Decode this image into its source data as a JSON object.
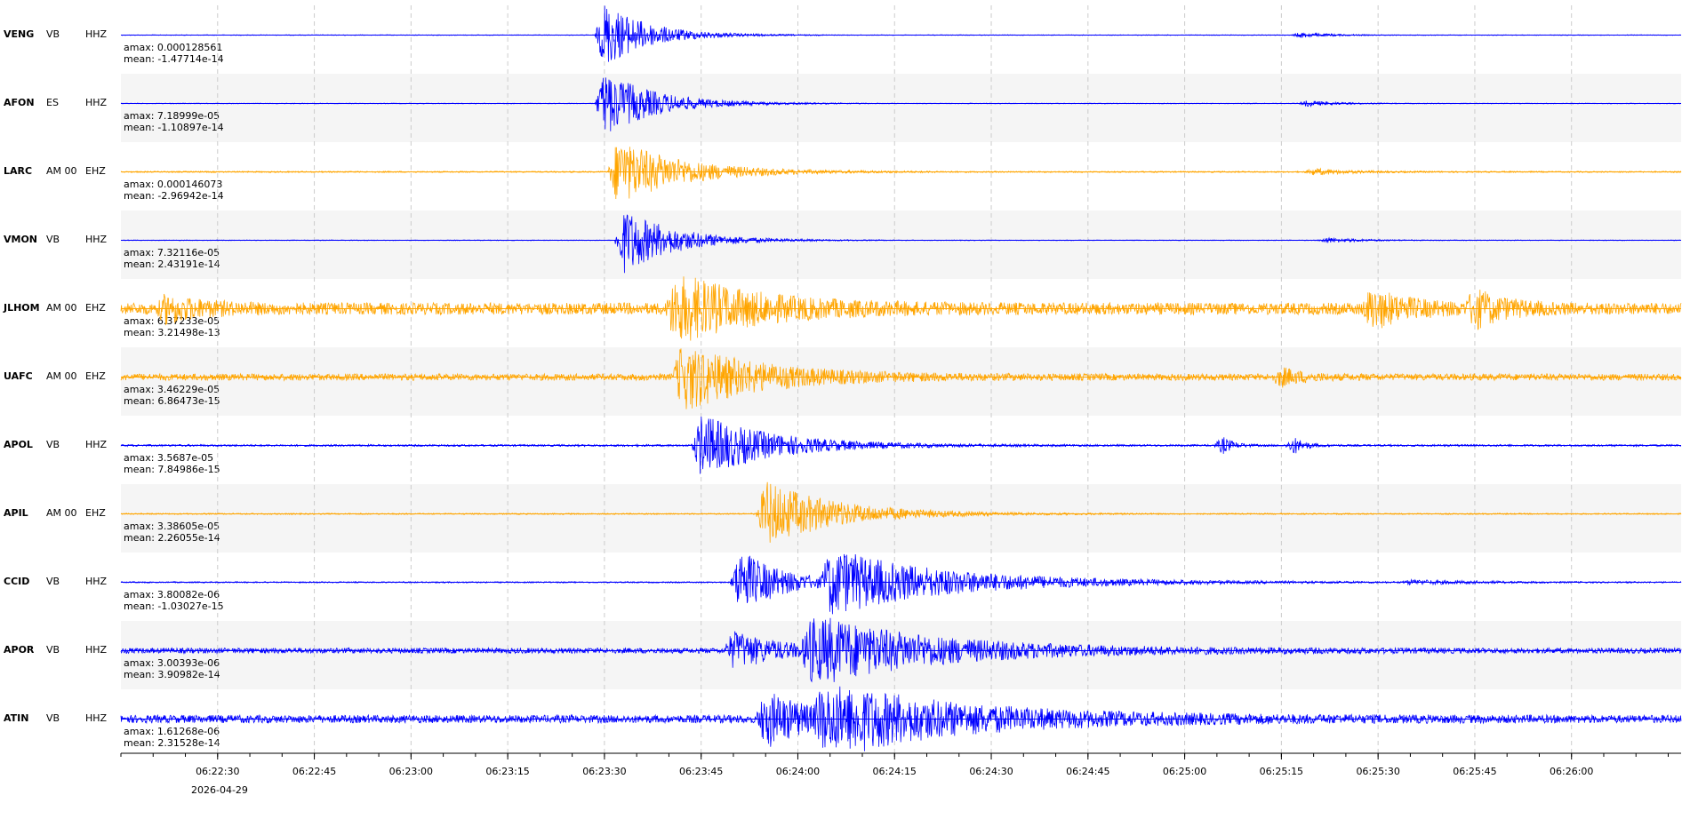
{
  "viewer": {
    "date": "2026-04-29",
    "time_ticks": [
      "06:22:30",
      "06:22:45",
      "06:23:00",
      "06:23:15",
      "06:23:30",
      "06:23:45",
      "06:24:00",
      "06:24:15",
      "06:24:30",
      "06:24:45",
      "06:25:00",
      "06:25:15",
      "06:25:30",
      "06:25:45",
      "06:26:00"
    ],
    "traces": [
      {
        "station": "VENG",
        "network": "VB",
        "location": "",
        "channel": "HHZ",
        "amax": "amax: 0.000128561",
        "mean": "mean: -1.47714e-14",
        "color": "#0000ff"
      },
      {
        "station": "AFON",
        "network": "ES",
        "location": "",
        "channel": "HHZ",
        "amax": "amax: 7.18999e-05",
        "mean": "mean: -1.10897e-14",
        "color": "#0000ff"
      },
      {
        "station": "LARC",
        "network": "AM 00",
        "location": "00",
        "channel": "EHZ",
        "amax": "amax: 0.000146073",
        "mean": "mean: -2.96942e-14",
        "color": "#ffa500"
      },
      {
        "station": "VMON",
        "network": "VB",
        "location": "",
        "channel": "HHZ",
        "amax": "amax: 7.32116e-05",
        "mean": "mean: 2.43191e-14",
        "color": "#0000ff"
      },
      {
        "station": "JLHOM",
        "network": "AM 00",
        "location": "00",
        "channel": "EHZ",
        "amax": "amax: 6.37233e-05",
        "mean": "mean: 3.21498e-13",
        "color": "#ffa500"
      },
      {
        "station": "UAFC",
        "network": "AM 00",
        "location": "00",
        "channel": "EHZ",
        "amax": "amax: 3.46229e-05",
        "mean": "mean: 6.86473e-15",
        "color": "#ffa500"
      },
      {
        "station": "APOL",
        "network": "VB",
        "location": "",
        "channel": "HHZ",
        "amax": "amax: 3.5687e-05",
        "mean": "mean: 7.84986e-15",
        "color": "#0000ff"
      },
      {
        "station": "APIL",
        "network": "AM 00",
        "location": "00",
        "channel": "EHZ",
        "amax": "amax: 3.38605e-05",
        "mean": "mean: 2.26055e-14",
        "color": "#ffa500"
      },
      {
        "station": "CCID",
        "network": "VB",
        "location": "",
        "channel": "HHZ",
        "amax": "amax: 3.80082e-06",
        "mean": "mean: -1.03027e-15",
        "color": "#0000ff"
      },
      {
        "station": "APOR",
        "network": "VB",
        "location": "",
        "channel": "HHZ",
        "amax": "amax: 3.00393e-06",
        "mean": "mean: 3.90982e-14",
        "color": "#0000ff"
      },
      {
        "station": "ATIN",
        "network": "VB",
        "location": "",
        "channel": "HHZ",
        "amax": "amax: 1.61268e-06",
        "mean": "mean: 2.31528e-14",
        "color": "#0000ff"
      }
    ]
  },
  "chart_data": {
    "type": "line",
    "title": "",
    "xlabel": "2026-04-29",
    "ylabel": "",
    "x_time_range": [
      "06:22:15",
      "06:26:17"
    ],
    "x_tick_labels": [
      "06:22:30",
      "06:22:45",
      "06:23:00",
      "06:23:15",
      "06:23:30",
      "06:23:45",
      "06:24:00",
      "06:24:15",
      "06:24:30",
      "06:24:45",
      "06:25:00",
      "06:25:15",
      "06:25:30",
      "06:25:45",
      "06:26:00"
    ],
    "grid": true,
    "series": [
      {
        "name": "VENG VB HHZ",
        "amax": 0.000128561,
        "mean": -1.47714e-14,
        "events": [
          {
            "t": "06:23:30",
            "rel_amp": 1.0,
            "dur_s": 12
          },
          {
            "t": "06:25:18",
            "rel_amp": 0.08,
            "dur_s": 8
          }
        ],
        "noise": 0.01
      },
      {
        "name": "AFON ES HHZ",
        "amax": 7.18999e-05,
        "mean": -1.10897e-14,
        "events": [
          {
            "t": "06:23:30",
            "rel_amp": 1.0,
            "dur_s": 14
          },
          {
            "t": "06:25:19",
            "rel_amp": 0.09,
            "dur_s": 8
          }
        ],
        "noise": 0.01
      },
      {
        "name": "LARC AM 00 EHZ",
        "amax": 0.000146073,
        "mean": -2.96942e-14,
        "events": [
          {
            "t": "06:23:32",
            "rel_amp": 1.0,
            "dur_s": 18
          },
          {
            "t": "06:25:20",
            "rel_amp": 0.1,
            "dur_s": 10
          }
        ],
        "noise": 0.02
      },
      {
        "name": "VMON VB HHZ",
        "amax": 7.32116e-05,
        "mean": 2.43191e-14,
        "events": [
          {
            "t": "06:23:33",
            "rel_amp": 1.0,
            "dur_s": 14
          },
          {
            "t": "06:25:22",
            "rel_amp": 0.08,
            "dur_s": 10
          }
        ],
        "noise": 0.01
      },
      {
        "name": "JLHOM AM 00 EHZ",
        "amax": 6.37233e-05,
        "mean": 3.21498e-13,
        "events": [
          {
            "t": "06:22:22",
            "rel_amp": 0.35,
            "dur_s": 10
          },
          {
            "t": "06:23:41",
            "rel_amp": 1.0,
            "dur_s": 22
          },
          {
            "t": "06:25:29",
            "rel_amp": 0.55,
            "dur_s": 10
          },
          {
            "t": "06:25:45",
            "rel_amp": 0.5,
            "dur_s": 8
          }
        ],
        "noise": 0.18
      },
      {
        "name": "UAFC AM 00 EHZ",
        "amax": 3.46229e-05,
        "mean": 6.86473e-15,
        "events": [
          {
            "t": "06:23:42",
            "rel_amp": 1.0,
            "dur_s": 22
          },
          {
            "t": "06:25:15",
            "rel_amp": 0.25,
            "dur_s": 6
          }
        ],
        "noise": 0.1
      },
      {
        "name": "APOL VB HHZ",
        "amax": 3.5687e-05,
        "mean": 7.84986e-15,
        "events": [
          {
            "t": "06:23:45",
            "rel_amp": 0.95,
            "dur_s": 20
          },
          {
            "t": "06:25:06",
            "rel_amp": 0.25,
            "dur_s": 3
          },
          {
            "t": "06:25:17",
            "rel_amp": 0.25,
            "dur_s": 3
          }
        ],
        "noise": 0.03
      },
      {
        "name": "APIL AM 00 EHZ",
        "amax": 3.38605e-05,
        "mean": 2.26055e-14,
        "events": [
          {
            "t": "06:23:55",
            "rel_amp": 1.0,
            "dur_s": 20
          }
        ],
        "noise": 0.02
      },
      {
        "name": "CCID VB HHZ",
        "amax": 3.80082e-06,
        "mean": -1.03027e-15,
        "events": [
          {
            "t": "06:23:51",
            "rel_amp": 1.0,
            "dur_s": 12
          },
          {
            "t": "06:24:05",
            "rel_amp": 0.95,
            "dur_s": 35
          },
          {
            "t": "06:25:35",
            "rel_amp": 0.06,
            "dur_s": 20
          }
        ],
        "noise": 0.02
      },
      {
        "name": "APOR VB HHZ",
        "amax": 3.00393e-06,
        "mean": 3.90982e-14,
        "events": [
          {
            "t": "06:23:50",
            "rel_amp": 0.55,
            "dur_s": 14
          },
          {
            "t": "06:24:02",
            "rel_amp": 1.0,
            "dur_s": 35
          }
        ],
        "noise": 0.08
      },
      {
        "name": "ATIN VB HHZ",
        "amax": 1.61268e-06,
        "mean": 2.31528e-14,
        "events": [
          {
            "t": "06:23:55",
            "rel_amp": 0.8,
            "dur_s": 14
          },
          {
            "t": "06:24:04",
            "rel_amp": 1.0,
            "dur_s": 40
          }
        ],
        "noise": 0.12
      }
    ]
  }
}
